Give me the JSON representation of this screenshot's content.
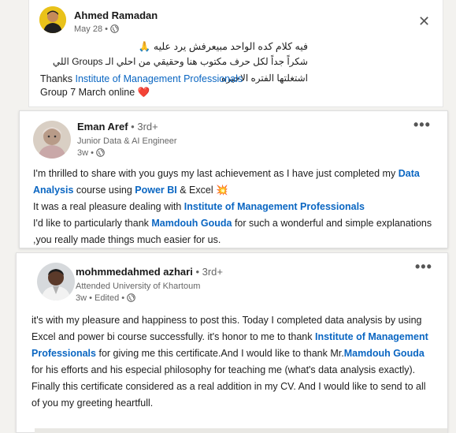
{
  "post1": {
    "author": "Ahmed Ramadan",
    "time": "May 28 •",
    "line1": "فيه كلام كده الواحد مبيعرفش يرد عليه 🙏",
    "line2": "شكراً جداً لكل حرف مكتوب هنا وحقيقي من احلي الـ Groups اللي اشتغلتها الفتره الاخيره",
    "thanks_prefix": "Thanks",
    "thanks_org": "Institute of Management Professionals",
    "group_line": "Group 7 March online ❤️",
    "close_icon": "✕",
    "more_icon": "•••"
  },
  "post2": {
    "author": "Eman Aref",
    "degree": "• 3rd+",
    "headline": "Junior Data & AI Engineer",
    "time": "3w •",
    "more_icon": "•••",
    "p1a": "I'm thrilled to share with you guys my last achievement as I have just completed my",
    "p1_course": "Data Analysis",
    "p1b": "course using",
    "p1_tool": "Power BI",
    "p1c": "& Excel 💥",
    "p2a": "It was a real pleasure dealing with",
    "p2_org": "Institute of Management Professionals",
    "p3a": "I'd like to particularly thank",
    "p3_person": "Mamdouh Gouda",
    "p3b": "for such a wonderful and simple explanations ,you really made things much easier for us."
  },
  "post3": {
    "author": "mohmmedahmed azhari",
    "degree": "• 3rd+",
    "headline": "Attended University of Khartoum",
    "time": "3w • Edited •",
    "more_icon": "•••",
    "p1a": "it's with my pleasure and happiness to post this. Today I completed data analysis by using Excel and power bi course successfully. it's honor to me to thank",
    "p1_org": "Institute of Management Professionals",
    "p1b": "for giving me this certificate.And I would like to thank Mr.",
    "p1_person": "Mamdouh Gouda",
    "p1c": "for his efforts and his especial philosophy for teaching me (what's data analysis exactly).",
    "p2": "Finally this certificate considered as a real addition in my CV. And I would like to send to all of you my greeting heartfull."
  }
}
